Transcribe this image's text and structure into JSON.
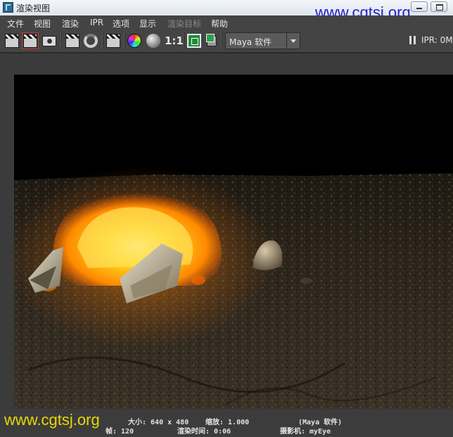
{
  "window": {
    "title": "渲染视图",
    "watermark": "www.cgtsj.org"
  },
  "menu": {
    "items": [
      "文件",
      "视图",
      "渲染",
      "IPR",
      "选项",
      "显示",
      "渲染目标",
      "帮助"
    ]
  },
  "toolbar": {
    "ratio_label": "1:1",
    "renderer": "Maya 软件",
    "ipr_status": "IPR: 0M"
  },
  "status": {
    "size_label": "大小: 640 x 480",
    "zoom_label": "缩放: 1.000",
    "renderer_label": "(Maya 软件)",
    "frame_label": "帧: 120",
    "render_time_label": "渲染时间: 0:06",
    "camera_label": "摄影机: myEye"
  },
  "colors": {
    "ui_background": "#444444",
    "fire_core": "#ffd21f",
    "fire_edge": "#ff7a00",
    "ground": "#2e271d",
    "watermark_top": "#2222cc",
    "watermark_bottom": "#e8d800"
  },
  "icons": [
    "render-frame-icon",
    "render-region-icon",
    "snapshot-icon",
    "render-sequence-icon",
    "refresh-icon",
    "keep-image-icon",
    "rgb-channel-icon",
    "alpha-channel-icon",
    "frame-all-icon",
    "remove-image-icon",
    "pause-icon"
  ]
}
